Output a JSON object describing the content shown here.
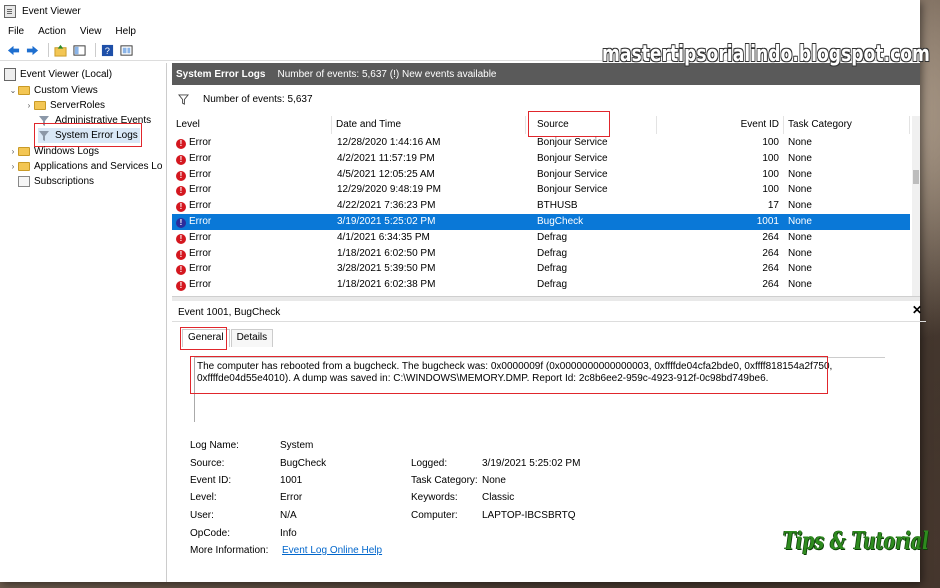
{
  "window": {
    "title": "Event Viewer"
  },
  "menu": [
    "File",
    "Action",
    "View",
    "Help"
  ],
  "tree": {
    "root": "Event Viewer (Local)",
    "custom_views": "Custom Views",
    "server_roles": "ServerRoles",
    "admin_events": "Administrative Events",
    "system_error_logs": "System Error Logs",
    "windows_logs": "Windows Logs",
    "apps_services": "Applications and Services Lo",
    "subscriptions": "Subscriptions"
  },
  "pane": {
    "title": "System Error Logs",
    "summary": "Number of events: 5,637 (!) New events available",
    "filter_text": "Number of events: 5,637"
  },
  "columns": {
    "level": "Level",
    "datetime": "Date and Time",
    "source": "Source",
    "eventid": "Event ID",
    "task": "Task Category"
  },
  "events": [
    {
      "level": "Error",
      "datetime": "12/28/2020 1:44:16 AM",
      "source": "Bonjour Service",
      "id": "100",
      "task": "None"
    },
    {
      "level": "Error",
      "datetime": "4/2/2021 11:57:19 PM",
      "source": "Bonjour Service",
      "id": "100",
      "task": "None"
    },
    {
      "level": "Error",
      "datetime": "4/5/2021 12:05:25 AM",
      "source": "Bonjour Service",
      "id": "100",
      "task": "None"
    },
    {
      "level": "Error",
      "datetime": "12/29/2020 9:48:19 PM",
      "source": "Bonjour Service",
      "id": "100",
      "task": "None"
    },
    {
      "level": "Error",
      "datetime": "4/22/2021 7:36:23 PM",
      "source": "BTHUSB",
      "id": "17",
      "task": "None"
    },
    {
      "level": "Error",
      "datetime": "3/19/2021 5:25:02 PM",
      "source": "BugCheck",
      "id": "1001",
      "task": "None"
    },
    {
      "level": "Error",
      "datetime": "4/1/2021 6:34:35 PM",
      "source": "Defrag",
      "id": "264",
      "task": "None"
    },
    {
      "level": "Error",
      "datetime": "1/18/2021 6:02:50 PM",
      "source": "Defrag",
      "id": "264",
      "task": "None"
    },
    {
      "level": "Error",
      "datetime": "3/28/2021 5:39:50 PM",
      "source": "Defrag",
      "id": "264",
      "task": "None"
    },
    {
      "level": "Error",
      "datetime": "1/18/2021 6:02:38 PM",
      "source": "Defrag",
      "id": "264",
      "task": "None"
    }
  ],
  "detail": {
    "title": "Event 1001, BugCheck",
    "tab_general": "General",
    "tab_details": "Details",
    "description": "The computer has rebooted from a bugcheck.  The bugcheck was: 0x0000009f (0x0000000000000003, 0xffffde04cfa2bde0, 0xffff818154a2f750, 0xffffde04d55e4010). A dump was saved in: C:\\WINDOWS\\MEMORY.DMP. Report Id: 2c8b6ee2-959c-4923-912f-0c98bd749be6.",
    "labels": {
      "log_name": "Log Name:",
      "source": "Source:",
      "event_id": "Event ID:",
      "level": "Level:",
      "user": "User:",
      "opcode": "OpCode:",
      "more_info": "More Information:",
      "logged": "Logged:",
      "task_category": "Task Category:",
      "keywords": "Keywords:",
      "computer": "Computer:"
    },
    "values": {
      "log_name": "System",
      "source": "BugCheck",
      "event_id": "1001",
      "level": "Error",
      "user": "N/A",
      "opcode": "Info",
      "more_info": "Event Log Online Help",
      "logged": "3/19/2021 5:25:02 PM",
      "task_category": "None",
      "keywords": "Classic",
      "computer": "LAPTOP-IBCSBRTQ"
    }
  },
  "watermark": "mastertipsorialindo.blogspot.com",
  "brand": "Tips & Tutorial",
  "colors": {
    "selection": "#0a78d7",
    "highlight_box": "#e0262c",
    "pane_header": "#5a5a5a",
    "error_icon": "#d4171f"
  }
}
